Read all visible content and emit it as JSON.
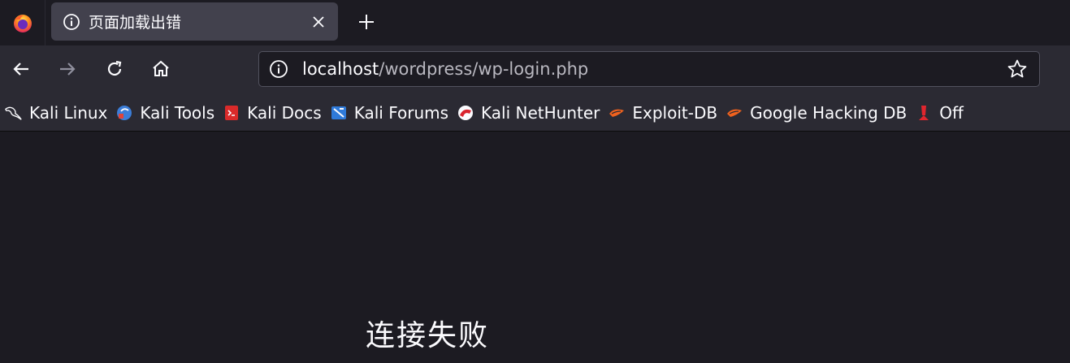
{
  "tab": {
    "title": "页面加载出错"
  },
  "urlbar": {
    "host": "localhost",
    "path": "/wordpress/wp-login.php"
  },
  "bookmarks": [
    {
      "label": "Kali Linux",
      "icon": "kali-dragon-icon"
    },
    {
      "label": "Kali Tools",
      "icon": "kali-tools-icon"
    },
    {
      "label": "Kali Docs",
      "icon": "kali-docs-icon"
    },
    {
      "label": "Kali Forums",
      "icon": "kali-forums-icon"
    },
    {
      "label": "Kali NetHunter",
      "icon": "kali-nethunter-icon"
    },
    {
      "label": "Exploit-DB",
      "icon": "exploit-db-icon"
    },
    {
      "label": "Google Hacking DB",
      "icon": "ghdb-icon"
    },
    {
      "label": "Off",
      "icon": "offsec-icon"
    }
  ],
  "error": {
    "title": "连接失败"
  },
  "colors": {
    "tab_bg": "#42414d",
    "toolbar_bg": "#2b2a33",
    "content_bg": "#1c1b22",
    "text": "#fbfbfe"
  }
}
